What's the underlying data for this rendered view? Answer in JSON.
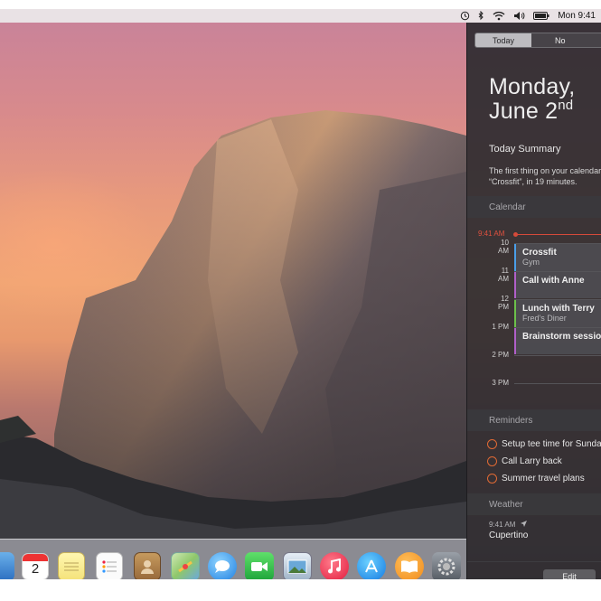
{
  "menubar": {
    "clock": "Mon 9:41",
    "icons": [
      "time-machine-icon",
      "bluetooth-icon",
      "wifi-icon",
      "volume-icon",
      "battery-icon"
    ]
  },
  "notification_center": {
    "tabs": [
      "Today",
      "No"
    ],
    "date_line1": "Monday,",
    "date_line2": "June 2",
    "date_suffix": "nd",
    "today_summary": {
      "title": "Today Summary",
      "line1": "The first thing on your calendar",
      "line2": "“Crossfit”, in 19 minutes."
    },
    "calendar": {
      "header": "Calendar",
      "now_label": "9:41 AM",
      "hours": [
        "10 AM",
        "11 AM",
        "12 PM",
        "1 PM",
        "2 PM",
        "3 PM"
      ],
      "events": [
        {
          "title": "Crossfit",
          "subtitle": "Gym",
          "color": "#4a9ee8"
        },
        {
          "title": "Call with Anne",
          "subtitle": "",
          "color": "#b05fc8"
        },
        {
          "title": "Lunch with Terry",
          "subtitle": "Fred's Diner",
          "color": "#6cc04a"
        },
        {
          "title": "Brainstorm session w",
          "subtitle": "",
          "color": "#b05fc8"
        }
      ]
    },
    "reminders": {
      "header": "Reminders",
      "items": [
        "Setup tee time for Sunday",
        "Call Larry back",
        "Summer travel plans"
      ]
    },
    "weather": {
      "header": "Weather",
      "time": "9:41 AM",
      "city": "Cupertino"
    },
    "edit_label": "Edit"
  },
  "dock": {
    "apps": [
      "Preview",
      "Calendar",
      "Notes",
      "Reminders",
      "Contacts",
      "Maps",
      "Messages",
      "FaceTime",
      "iPhoto",
      "iTunes",
      "App Store",
      "iBooks",
      "System Preferences"
    ],
    "calendar_day": "2"
  }
}
